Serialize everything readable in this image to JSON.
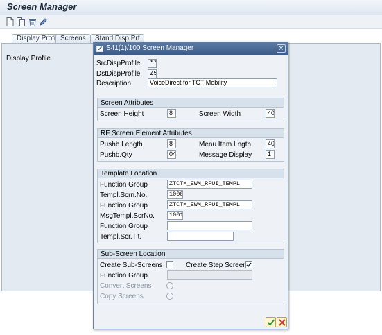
{
  "window": {
    "title": "Screen Manager",
    "toolbar": [
      "new-icon",
      "copy-icon",
      "delete-icon",
      "edit-icon"
    ]
  },
  "tabs": [
    "Display Profile",
    "Screens",
    "Stand.Disp.Prf"
  ],
  "content": {
    "label": "Display Profile"
  },
  "dialog": {
    "title": "S41(1)/100 Screen Manager",
    "src_label": "SrcDispProfile",
    "src_value": "**",
    "dst_label": "DstDispProfile",
    "dst_value": "Z5",
    "desc_label": "Description",
    "desc_value": "VoiceDirect for TCT Mobility",
    "screen_attributes": {
      "header": "Screen Attributes",
      "height_label": "Screen Height",
      "height_value": "8",
      "width_label": "Screen Width",
      "width_value": "40"
    },
    "rf_attributes": {
      "header": "RF Screen Element Attributes",
      "pushb_length_label": "Pushb.Length",
      "pushb_length_value": "8",
      "menu_length_label": "Menu Item Lngth",
      "menu_length_value": "40",
      "pushb_qty_label": "Pushb.Qty",
      "pushb_qty_value": "04",
      "msg_display_label": "Message Display",
      "msg_display_value": "1"
    },
    "template_location": {
      "header": "Template Location",
      "fg1_label": "Function Group",
      "fg1_value": "ZTCTM_EWM_RFUI_TEMPL",
      "scrn_label": "Templ.Scrn.No.",
      "scrn_value": "1000",
      "fg2_label": "Function Group",
      "fg2_value": "ZTCTM_EWM_RFUI_TEMPL",
      "msg_label": "MsgTempl.ScrNo.",
      "msg_value": "1001",
      "fg3_label": "Function Group",
      "fg3_value": "",
      "tit_label": "Templ.Scr.Tit.",
      "tit_value": ""
    },
    "sub_screen": {
      "header": "Sub-Screen Location",
      "create_sub_label": "Create Sub-Screens",
      "create_sub_checked": false,
      "create_step_label": "Create Step Screen",
      "create_step_checked": true,
      "fg_label": "Function Group",
      "fg_value": "",
      "convert_label": "Convert Screens",
      "copy_label": "Copy Screens"
    },
    "buttons": [
      "confirm-icon",
      "cancel-icon"
    ]
  }
}
